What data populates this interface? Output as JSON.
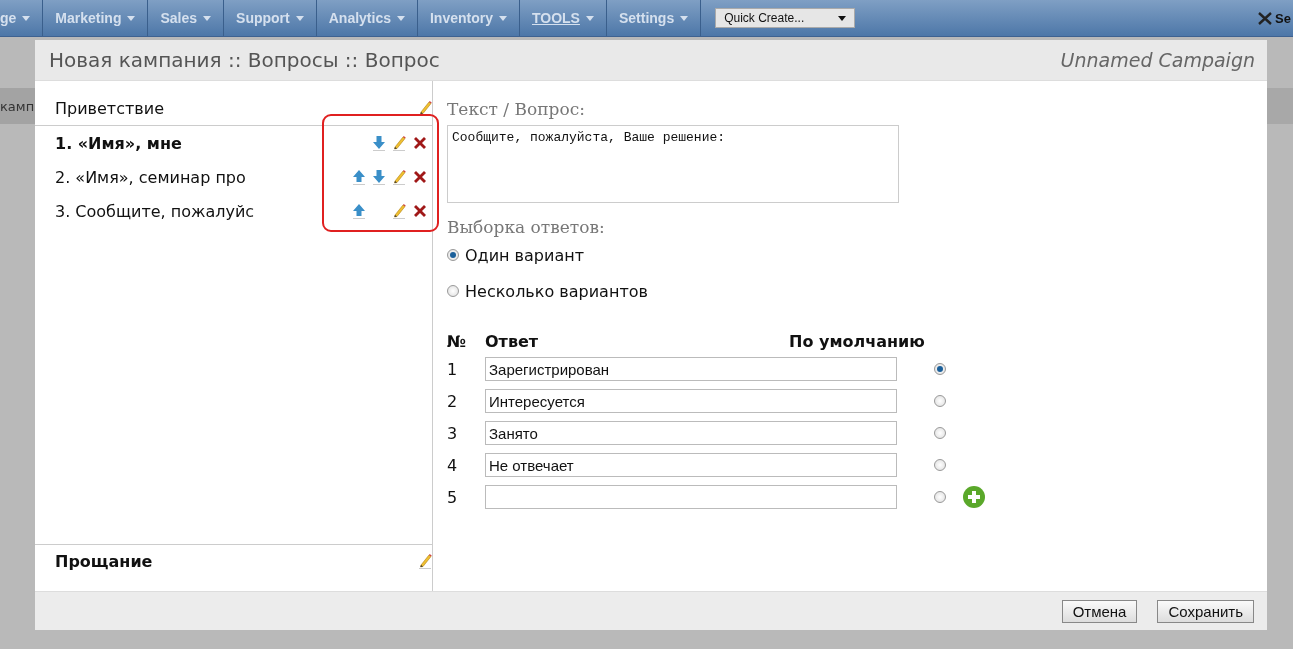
{
  "nav": {
    "items": [
      {
        "label": "ge",
        "underlined": false
      },
      {
        "label": "Marketing",
        "underlined": false
      },
      {
        "label": "Sales",
        "underlined": false
      },
      {
        "label": "Support",
        "underlined": false
      },
      {
        "label": "Analytics",
        "underlined": false
      },
      {
        "label": "Inventory",
        "underlined": false
      },
      {
        "label": "TOOLS",
        "underlined": true
      },
      {
        "label": "Settings",
        "underlined": false
      }
    ],
    "quick_create": "Quick Create...",
    "right_link": "Se"
  },
  "background_text": "камп",
  "dialog": {
    "title": "Новая кампания :: Вопросы :: Вопрос",
    "campaign": "Unnamed Campaign",
    "sidebar": {
      "greeting": "Приветствие",
      "questions": [
        {
          "text": "1. «Имя», мне",
          "selected": true,
          "can_move_up": false,
          "can_move_down": true
        },
        {
          "text": "2. «Имя», семинар про",
          "selected": false,
          "can_move_up": true,
          "can_move_down": true
        },
        {
          "text": "3. Сообщите, пожалуйс",
          "selected": false,
          "can_move_up": true,
          "can_move_down": false
        }
      ],
      "farewell": "Прощание"
    },
    "form": {
      "text_label": "Текст / Вопрос:",
      "text_value": "Сообщите, пожалуйста, Ваше решение:",
      "choice_label": "Выборка ответов:",
      "choice_modes": [
        {
          "label": "Один вариант",
          "selected": true
        },
        {
          "label": "Несколько вариантов",
          "selected": false
        }
      ],
      "columns": [
        "№",
        "Ответ",
        "По умолчанию"
      ],
      "answers": [
        {
          "number": "1",
          "value": "Зарегистрирован",
          "selected": true
        },
        {
          "number": "2",
          "value": "Интересуется",
          "selected": false
        },
        {
          "number": "3",
          "value": "Занято",
          "selected": false
        },
        {
          "number": "4",
          "value": "Не отвечает",
          "selected": false
        },
        {
          "number": "5",
          "selected": false
        }
      ]
    },
    "buttons": [
      "Отмена",
      "Сохранить"
    ]
  }
}
